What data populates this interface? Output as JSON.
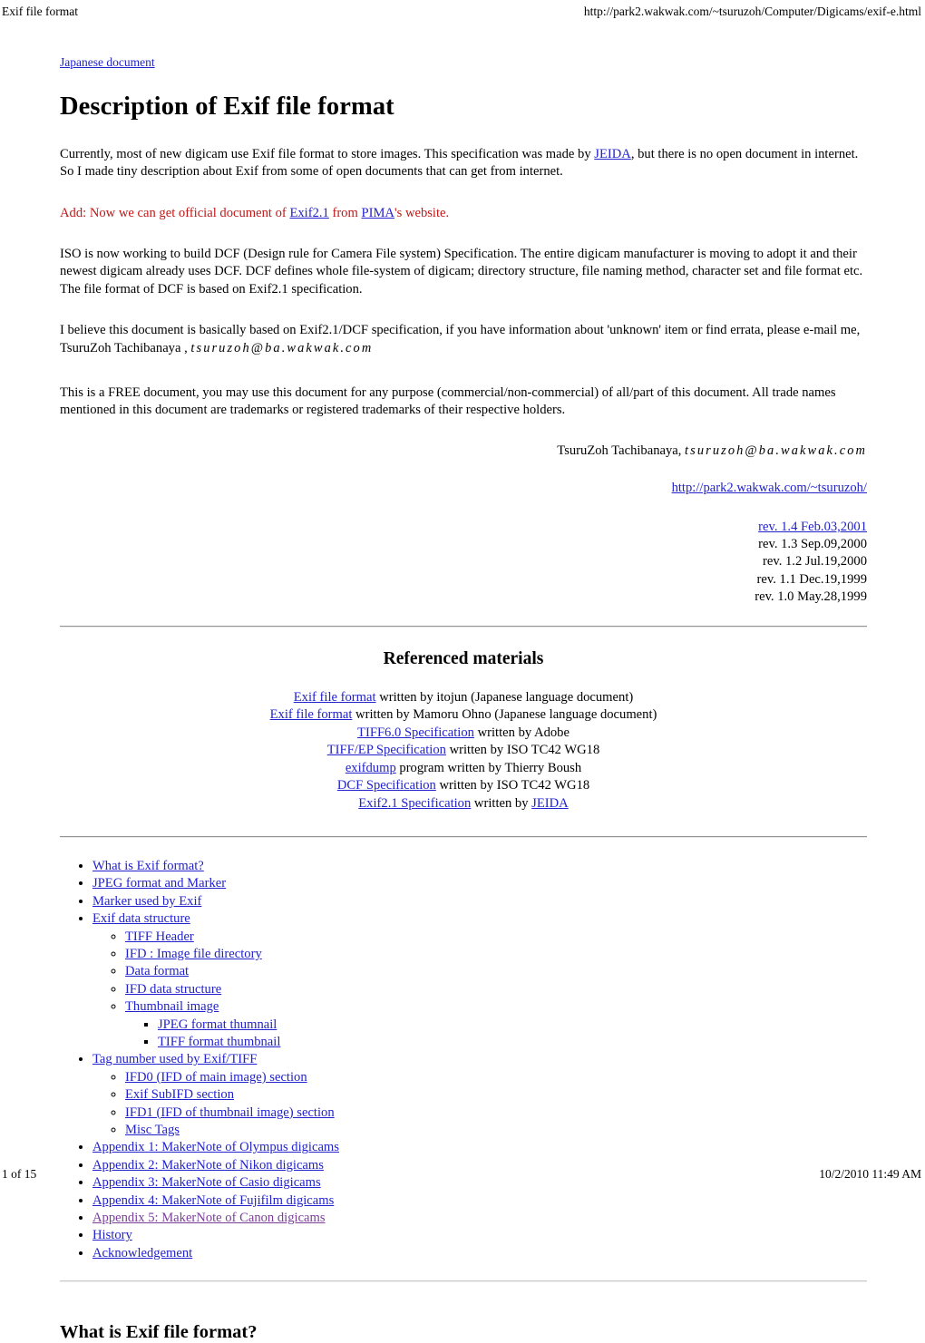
{
  "browser_chrome": {
    "header_left": "Exif file format",
    "header_right": "http://park2.wakwak.com/~tsuruzoh/Computer/Digicams/exif-e.html",
    "footer_left": "1 of 15",
    "footer_right": "10/2/2010 11:49 AM"
  },
  "colors": {
    "link": "#2222cc",
    "visited_link": "#7b3f99",
    "note_red": "#c01818",
    "text": "#000000",
    "background": "#ffffff"
  },
  "document": {
    "top_link": "Japanese document",
    "title": "Description of Exif file format",
    "intro": {
      "part1": "Currently, most of new digicam use Exif file format to store images. This specification was made by ",
      "link_jeida": "JEIDA",
      "part2": ", but there is no open document in internet. So I made tiny description about Exif from some of open documents that can get from internet."
    },
    "add_note": {
      "part1": "Add: Now we can get official document of ",
      "link_exif21": "Exif2.1",
      "part2": " from ",
      "link_pima": "PIMA",
      "part3": "'s website."
    },
    "iso_para": "ISO is now working to build DCF (Design rule for Camera File system) Specification. The entire digicam manufacturer is moving to adopt it and their newest digicam already uses DCF. DCF defines whole file-system of digicam; directory structure, file naming method, character set and file format etc. The file format of DCF is based on Exif2.1 specification.",
    "believe_para": {
      "part1": "I believe this document is basically based on Exif2.1/DCF specification, if you have information about 'unknown' item or find errata, please e-mail me, TsuruZoh Tachibanaya , ",
      "email": "tsuruzoh@ba.wakwak.com"
    },
    "free_para": "This is a FREE document, you may use this document for any purpose (commercial/non-commercial) of all/part of this document. All trade names mentioned in this document are trademarks or registered trademarks of their respective holders.",
    "signature": {
      "name": "TsuruZoh Tachibanaya, ",
      "email": "tsuruzoh@ba.wakwak.com"
    },
    "site_link": "http://park2.wakwak.com/~tsuruzoh/",
    "revisions": [
      {
        "label": "rev. 1.4 Feb.03,2001",
        "is_link": true
      },
      {
        "label": "rev. 1.3 Sep.09,2000",
        "is_link": false
      },
      {
        "label": "rev. 1.2 Jul.19,2000",
        "is_link": false
      },
      {
        "label": "rev. 1.1 Dec.19,1999",
        "is_link": false
      },
      {
        "label": "rev. 1.0 May.28,1999",
        "is_link": false
      }
    ]
  },
  "referenced_materials": {
    "heading": "Referenced materials",
    "items": [
      {
        "link": "Exif file format",
        "rest": " written by itojun (Japanese language document)"
      },
      {
        "link": "Exif file format",
        "rest": " written by Mamoru Ohno (Japanese language document)"
      },
      {
        "link": "TIFF6.0 Specification",
        "rest": " written by Adobe"
      },
      {
        "link": "TIFF/EP Specification",
        "rest": " written by ISO TC42 WG18"
      },
      {
        "link": "exifdump",
        "rest": " program written by Thierry Boush"
      },
      {
        "link": "DCF Specification",
        "rest": " written by ISO TC42 WG18"
      },
      {
        "link": "Exif2.1 Specification",
        "rest": " written by ",
        "trailing_link": "JEIDA"
      }
    ]
  },
  "toc": [
    {
      "label": "What is Exif format?",
      "visited": false
    },
    {
      "label": "JPEG format and Marker",
      "visited": false
    },
    {
      "label": "Marker used by Exif",
      "visited": false
    },
    {
      "label": "Exif data structure",
      "visited": false,
      "children": [
        {
          "label": "TIFF Header",
          "visited": false
        },
        {
          "label": "IFD : Image file directory",
          "visited": false
        },
        {
          "label": "Data format",
          "visited": false
        },
        {
          "label": "IFD data structure",
          "visited": false
        },
        {
          "label": "Thumbnail image",
          "visited": false,
          "children": [
            {
              "label": "JPEG format thumnail",
              "visited": false
            },
            {
              "label": "TIFF format thumbnail",
              "visited": false
            }
          ]
        }
      ]
    },
    {
      "label": "Tag number used by Exif/TIFF",
      "visited": false,
      "children": [
        {
          "label": "IFD0 (IFD of main image) section",
          "visited": false
        },
        {
          "label": "Exif SubIFD section",
          "visited": false
        },
        {
          "label": "IFD1 (IFD of thumbnail image) section",
          "visited": false
        },
        {
          "label": "Misc Tags",
          "visited": false
        }
      ]
    },
    {
      "label": "Appendix 1: MakerNote of Olympus digicams",
      "visited": false
    },
    {
      "label": "Appendix 2: MakerNote of Nikon digicams",
      "visited": false
    },
    {
      "label": "Appendix 3: MakerNote of Casio digicams",
      "visited": false
    },
    {
      "label": "Appendix 4: MakerNote of Fujifilm digicams",
      "visited": false
    },
    {
      "label": "Appendix 5: MakerNote of Canon digicams",
      "visited": true
    },
    {
      "label": "History",
      "visited": false
    },
    {
      "label": "Acknowledgement",
      "visited": false
    }
  ],
  "bottom_section": {
    "heading": "What is Exif file format?"
  }
}
